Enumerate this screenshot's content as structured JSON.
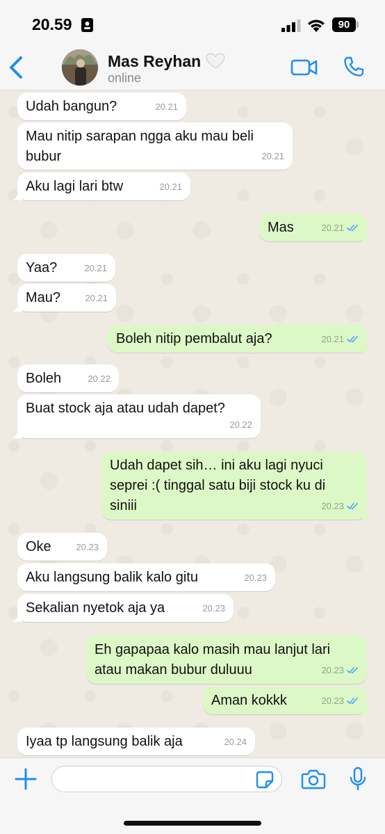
{
  "status_bar": {
    "time": "20.59",
    "battery": "90"
  },
  "header": {
    "name": "Mas Reyhan",
    "status": "online"
  },
  "colors": {
    "accent": "#1f8ef1",
    "outgoing_bubble": "#dcf8c6",
    "incoming_bubble": "#ffffff",
    "read_tick": "#4fa5f5"
  },
  "icons": {
    "back": "chevron-left-icon",
    "heart": "white-heart-icon",
    "video": "video-camera-icon",
    "call": "phone-icon",
    "plus": "plus-icon",
    "sticker": "sticker-icon",
    "camera": "camera-icon",
    "mic": "microphone-icon"
  },
  "messages": [
    {
      "dir": "in",
      "text": "Udah bangun?",
      "time": "20.21"
    },
    {
      "dir": "in",
      "text": "Mau nitip sarapan ngga aku mau beli\nbubur",
      "time": "20.21"
    },
    {
      "dir": "in",
      "text": "Aku lagi lari btw",
      "time": "20.21"
    },
    {
      "dir": "out",
      "text": "Mas",
      "time": "20.21",
      "read": true
    },
    {
      "dir": "in",
      "text": "Yaa?",
      "time": "20.21"
    },
    {
      "dir": "in",
      "text": "Mau?",
      "time": "20.21"
    },
    {
      "dir": "out",
      "text": "Boleh nitip pembalut aja?",
      "time": "20.21",
      "read": true
    },
    {
      "dir": "in",
      "text": "Boleh",
      "time": "20.22"
    },
    {
      "dir": "in",
      "text": "Buat stock aja atau udah dapet?",
      "time": "20.22"
    },
    {
      "dir": "out",
      "text": "Udah dapet sih… ini aku lagi nyuci\nseprei :( tinggal satu biji stock ku di\nsiniii",
      "time": "20.23",
      "read": true
    },
    {
      "dir": "in",
      "text": "Oke",
      "time": "20.23"
    },
    {
      "dir": "in",
      "text": "Aku langsung balik kalo gitu",
      "time": "20.23"
    },
    {
      "dir": "in",
      "text": "Sekalian nyetok aja ya",
      "time": "20.23"
    },
    {
      "dir": "out",
      "text": "Eh gapapaa kalo masih mau lanjut lari\natau makan bubur duluuu",
      "time": "20.23",
      "read": true
    },
    {
      "dir": "out",
      "text": "Aman kokkk",
      "time": "20.23",
      "read": true
    },
    {
      "dir": "in",
      "text": "Iyaa tp langsung balik aja",
      "time": "20.24"
    }
  ]
}
